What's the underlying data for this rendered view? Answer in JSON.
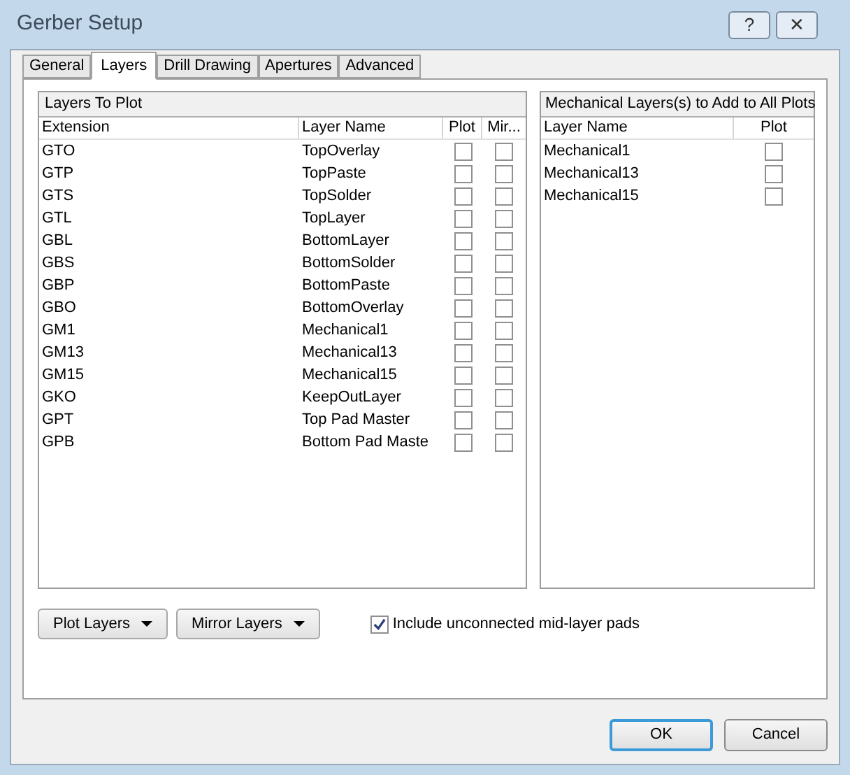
{
  "window": {
    "title": "Gerber Setup",
    "buttons": [
      "?",
      "✕"
    ]
  },
  "tabs": [
    {
      "label": "General",
      "selected": false
    },
    {
      "label": "Layers",
      "selected": true
    },
    {
      "label": "Drill Drawing",
      "selected": false
    },
    {
      "label": "Apertures",
      "selected": false
    },
    {
      "label": "Advanced",
      "selected": false
    }
  ],
  "layers_to_plot": {
    "title": "Layers To Plot",
    "columns": [
      "Extension",
      "Layer Name",
      "Plot",
      "Mir..."
    ],
    "rows": [
      {
        "extension": "GTO",
        "layer_name": "TopOverlay",
        "plot": false,
        "mirror": false
      },
      {
        "extension": "GTP",
        "layer_name": "TopPaste",
        "plot": false,
        "mirror": false
      },
      {
        "extension": "GTS",
        "layer_name": "TopSolder",
        "plot": false,
        "mirror": false
      },
      {
        "extension": "GTL",
        "layer_name": "TopLayer",
        "plot": false,
        "mirror": false
      },
      {
        "extension": "GBL",
        "layer_name": "BottomLayer",
        "plot": false,
        "mirror": false
      },
      {
        "extension": "GBS",
        "layer_name": "BottomSolder",
        "plot": false,
        "mirror": false
      },
      {
        "extension": "GBP",
        "layer_name": "BottomPaste",
        "plot": false,
        "mirror": false
      },
      {
        "extension": "GBO",
        "layer_name": "BottomOverlay",
        "plot": false,
        "mirror": false
      },
      {
        "extension": "GM1",
        "layer_name": "Mechanical1",
        "plot": false,
        "mirror": false
      },
      {
        "extension": "GM13",
        "layer_name": "Mechanical13",
        "plot": false,
        "mirror": false
      },
      {
        "extension": "GM15",
        "layer_name": "Mechanical15",
        "plot": false,
        "mirror": false
      },
      {
        "extension": "GKO",
        "layer_name": "KeepOutLayer",
        "plot": false,
        "mirror": false
      },
      {
        "extension": "GPT",
        "layer_name": "Top Pad Master",
        "plot": false,
        "mirror": false
      },
      {
        "extension": "GPB",
        "layer_name": "Bottom Pad Maste",
        "plot": false,
        "mirror": false
      }
    ]
  },
  "mechanical_layers": {
    "title": "Mechanical Layers(s) to Add to All Plots",
    "columns": [
      "Layer Name",
      "Plot"
    ],
    "rows": [
      {
        "layer_name": "Mechanical1",
        "plot": false
      },
      {
        "layer_name": "Mechanical13",
        "plot": false
      },
      {
        "layer_name": "Mechanical15",
        "plot": false
      }
    ]
  },
  "menu_buttons": [
    "Plot Layers",
    "Mirror Layers"
  ],
  "include_pads": {
    "label": "Include unconnected mid-layer pads",
    "checked": true
  },
  "dialog_buttons": [
    {
      "label": "OK",
      "default": true
    },
    {
      "label": "Cancel",
      "default": false
    }
  ]
}
